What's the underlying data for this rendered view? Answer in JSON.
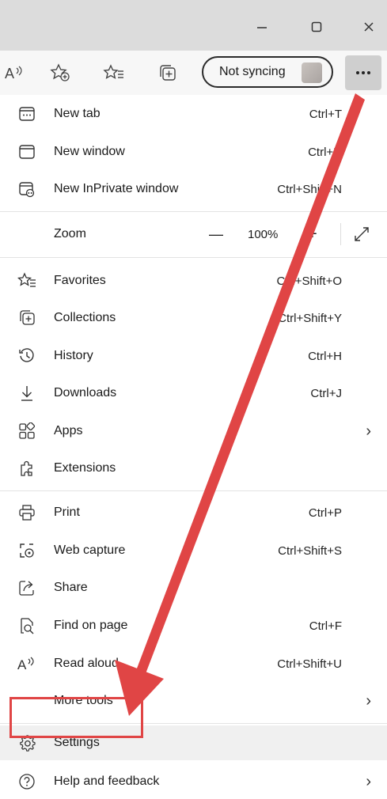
{
  "window_controls": {
    "minimize": "minimize-icon",
    "maximize": "maximize-icon",
    "close": "close-icon"
  },
  "toolbar": {
    "icons": [
      "read-aloud-icon",
      "add-favorite-icon",
      "favorites-icon",
      "collections-icon",
      "more-icon"
    ],
    "profile_label": "Not syncing"
  },
  "menu": {
    "new_tab": {
      "label": "New tab",
      "shortcut": "Ctrl+T"
    },
    "new_window": {
      "label": "New window",
      "shortcut": "Ctrl+N"
    },
    "new_inprivate": {
      "label": "New InPrivate window",
      "shortcut": "Ctrl+Shift+N"
    },
    "zoom": {
      "label": "Zoom",
      "minus": "—",
      "value": "100%",
      "plus": "+"
    },
    "favorites": {
      "label": "Favorites",
      "shortcut": "Ctrl+Shift+O"
    },
    "collections": {
      "label": "Collections",
      "shortcut": "Ctrl+Shift+Y"
    },
    "history": {
      "label": "History",
      "shortcut": "Ctrl+H"
    },
    "downloads": {
      "label": "Downloads",
      "shortcut": "Ctrl+J"
    },
    "apps": {
      "label": "Apps"
    },
    "extensions": {
      "label": "Extensions"
    },
    "print": {
      "label": "Print",
      "shortcut": "Ctrl+P"
    },
    "web_capture": {
      "label": "Web capture",
      "shortcut": "Ctrl+Shift+S"
    },
    "share": {
      "label": "Share"
    },
    "find_on_page": {
      "label": "Find on page",
      "shortcut": "Ctrl+F"
    },
    "read_aloud": {
      "label": "Read aloud",
      "shortcut": "Ctrl+Shift+U"
    },
    "more_tools": {
      "label": "More tools"
    },
    "settings": {
      "label": "Settings"
    },
    "help_feedback": {
      "label": "Help and feedback"
    },
    "chevron": "›"
  },
  "colors": {
    "annotation_red": "#e04545",
    "titlebar": "#dcdcdc",
    "more_button": "#cfcfcf"
  }
}
